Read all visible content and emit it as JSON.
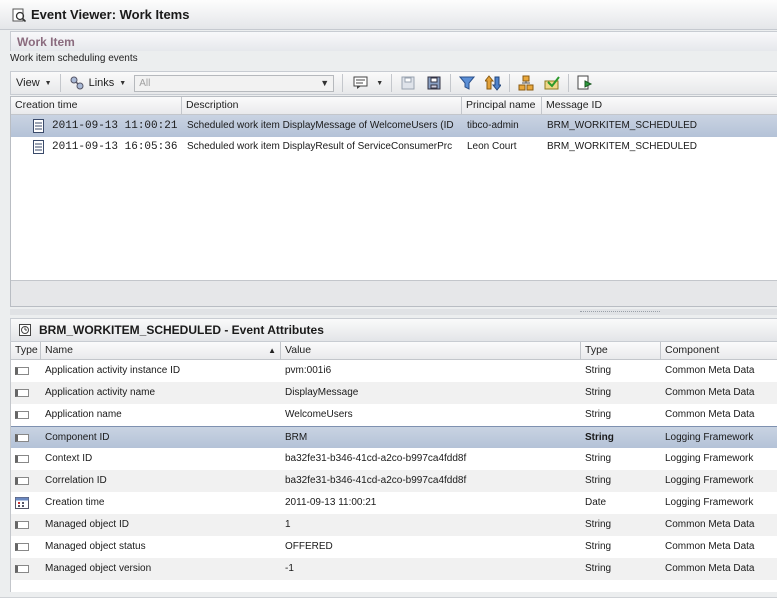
{
  "window": {
    "title": "Event Viewer: Work Items"
  },
  "section": {
    "title": "Work Item",
    "subtitle": "Work item scheduling events"
  },
  "toolbar": {
    "view_label": "View",
    "links_label": "Links",
    "filter_placeholder": "All"
  },
  "events_table": {
    "columns": [
      "Creation time",
      "Description",
      "Principal name",
      "Message ID"
    ],
    "rows": [
      {
        "time": "2011-09-13 11:00:21",
        "description": "Scheduled work item DisplayMessage of WelcomeUsers (ID",
        "principal": "tibco-admin",
        "message_id": "BRM_WORKITEM_SCHEDULED",
        "selected": true
      },
      {
        "time": "2011-09-13 16:05:36",
        "description": "Scheduled work item DisplayResult of ServiceConsumerPrc",
        "principal": "Leon Court",
        "message_id": "BRM_WORKITEM_SCHEDULED",
        "selected": false
      }
    ]
  },
  "attributes": {
    "title": "BRM_WORKITEM_SCHEDULED - Event Attributes",
    "columns": [
      "Type",
      "Name",
      "Value",
      "Type",
      "Component"
    ],
    "sort_indicator": "▲",
    "rows": [
      {
        "icon": "text-type-icon",
        "name": "Application activity instance ID",
        "value": "pvm:001i6",
        "type": "String",
        "component": "Common Meta Data"
      },
      {
        "icon": "text-type-icon",
        "name": "Application activity name",
        "value": "DisplayMessage",
        "type": "String",
        "component": "Common Meta Data"
      },
      {
        "icon": "text-type-icon",
        "name": "Application name",
        "value": "WelcomeUsers",
        "type": "String",
        "component": "Common Meta Data"
      },
      {
        "icon": "text-type-icon",
        "name": "Component ID",
        "value": "BRM",
        "type": "String",
        "component": "Logging Framework",
        "selected": true
      },
      {
        "icon": "text-type-icon",
        "name": "Context ID",
        "value": "ba32fe31-b346-41cd-a2co-b997ca4fdd8f",
        "type": "String",
        "component": "Logging Framework"
      },
      {
        "icon": "text-type-icon",
        "name": "Correlation ID",
        "value": "ba32fe31-b346-41cd-a2co-b997ca4fdd8f",
        "type": "String",
        "component": "Logging Framework"
      },
      {
        "icon": "date-type-icon",
        "name": "Creation time",
        "value": "2011-09-13 11:00:21",
        "type": "Date",
        "component": "Logging Framework"
      },
      {
        "icon": "text-type-icon",
        "name": "Managed object ID",
        "value": "1",
        "type": "String",
        "component": "Common Meta Data"
      },
      {
        "icon": "text-type-icon",
        "name": "Managed object status",
        "value": "OFFERED",
        "type": "String",
        "component": "Common Meta Data"
      },
      {
        "icon": "text-type-icon",
        "name": "Managed object version",
        "value": "-1",
        "type": "String",
        "component": "Common Meta Data"
      }
    ]
  }
}
